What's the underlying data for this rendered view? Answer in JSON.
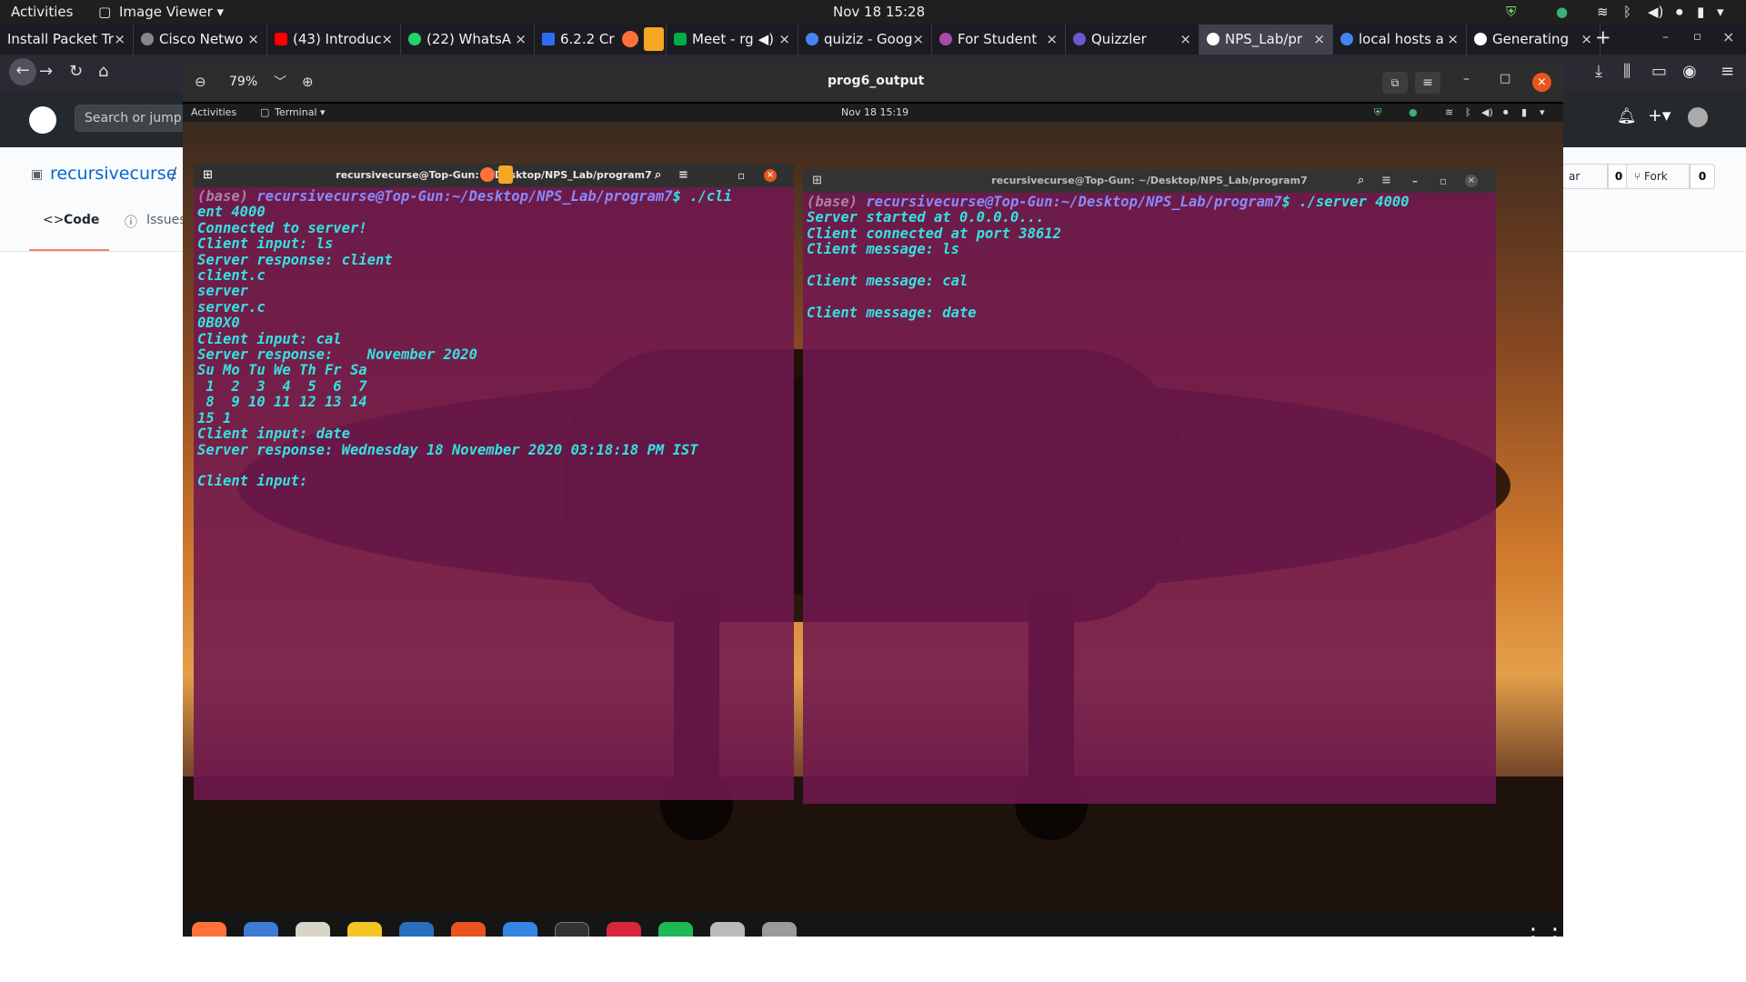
{
  "topbar": {
    "activities": "Activities",
    "app_menu": "Image Viewer ▾",
    "clock": "Nov 18  15:28"
  },
  "browser": {
    "tabs": [
      {
        "label": "Install Packet Tr",
        "color": "#e8e8e8"
      },
      {
        "label": "Cisco Netwo",
        "color": "#888888"
      },
      {
        "label": "(43) Introduc",
        "color": "#ff0000"
      },
      {
        "label": "(22) WhatsA",
        "color": "#25d366"
      },
      {
        "label": "6.2.2 Cr",
        "color": "#2d6df6"
      },
      {
        "label": "Meet - rg",
        "color": "#00ac47"
      },
      {
        "label": "quiziz - Goog",
        "color": "#4285f4"
      },
      {
        "label": "For Student",
        "color": "#a94caf"
      },
      {
        "label": "Quizzler",
        "color": "#6a5acd"
      },
      {
        "label": "NPS_Lab/pr",
        "color": "#ffffff"
      },
      {
        "label": "local hosts a",
        "color": "#4285f4"
      },
      {
        "label": "Generating",
        "color": "#ffffff"
      }
    ],
    "close_glyph": "×",
    "new_tab": "+"
  },
  "github": {
    "search_placeholder": "Search or jump to",
    "repo_owner": "recursivecurse",
    "slash": "/",
    "tab_code": "Code",
    "tab_issues": "Issues",
    "star_label": "ar",
    "star_count": "0",
    "fork_label": "Fork",
    "fork_count": "0"
  },
  "viewer": {
    "title": "prog6_output",
    "zoom": "79%"
  },
  "inner": {
    "activities": "Activities",
    "terminal_menu": "Terminal ▾",
    "clock": "Nov 18  15:19"
  },
  "client_terminal": {
    "title": "recursivecurse@Top-Gun: ~/Desktop/NPS_Lab/program7",
    "prompt_base": "(base) ",
    "prompt_user": "recursivecurse@Top-Gun",
    "prompt_path": ":~/Desktop/NPS_Lab/program7",
    "prompt_cmd": "$ ./cli",
    "lines": [
      "ent 4000",
      "Connected to server!",
      "Client input: ls",
      "Server response: client",
      "client.c",
      "server",
      "server.c",
      "0B0X0",
      "Client input: cal",
      "Server response:    November 2020",
      "Su Mo Tu We Th Fr Sa",
      " 1  2  3  4  5  6  7",
      " 8  9 10 11 12 13 14",
      "15 1",
      "Client input: date",
      "Server response: Wednesday 18 November 2020 03:18:18 PM IST",
      "",
      "Client input:"
    ]
  },
  "server_terminal": {
    "title": "recursivecurse@Top-Gun: ~/Desktop/NPS_Lab/program7",
    "prompt_base": "(base) ",
    "prompt_user": "recursivecurse@Top-Gun",
    "prompt_path": ":~/Desktop/NPS_Lab/program7",
    "prompt_cmd": "$ ./server 4000",
    "lines": [
      "Server started at 0.0.0.0...",
      "Client connected at port 38612",
      "Client message: ls",
      "",
      "Client message: cal",
      "",
      "Client message: date"
    ]
  },
  "dock_apps": [
    {
      "name": "firefox",
      "color": "#ff7139"
    },
    {
      "name": "thunderbird",
      "color": "#3d7bd4"
    },
    {
      "name": "files",
      "color": "#d9d4c8"
    },
    {
      "name": "rhythmbox",
      "color": "#f3c623"
    },
    {
      "name": "writer",
      "color": "#2a6ebd"
    },
    {
      "name": "software",
      "color": "#e95420"
    },
    {
      "name": "help",
      "color": "#3584e4"
    },
    {
      "name": "terminal",
      "color": "#333333"
    },
    {
      "name": "packet-tracer",
      "color": "#d7263d"
    },
    {
      "name": "spotify",
      "color": "#1db954"
    },
    {
      "name": "usb",
      "color": "#bbbbbb"
    },
    {
      "name": "disk",
      "color": "#9a9a9a"
    }
  ]
}
